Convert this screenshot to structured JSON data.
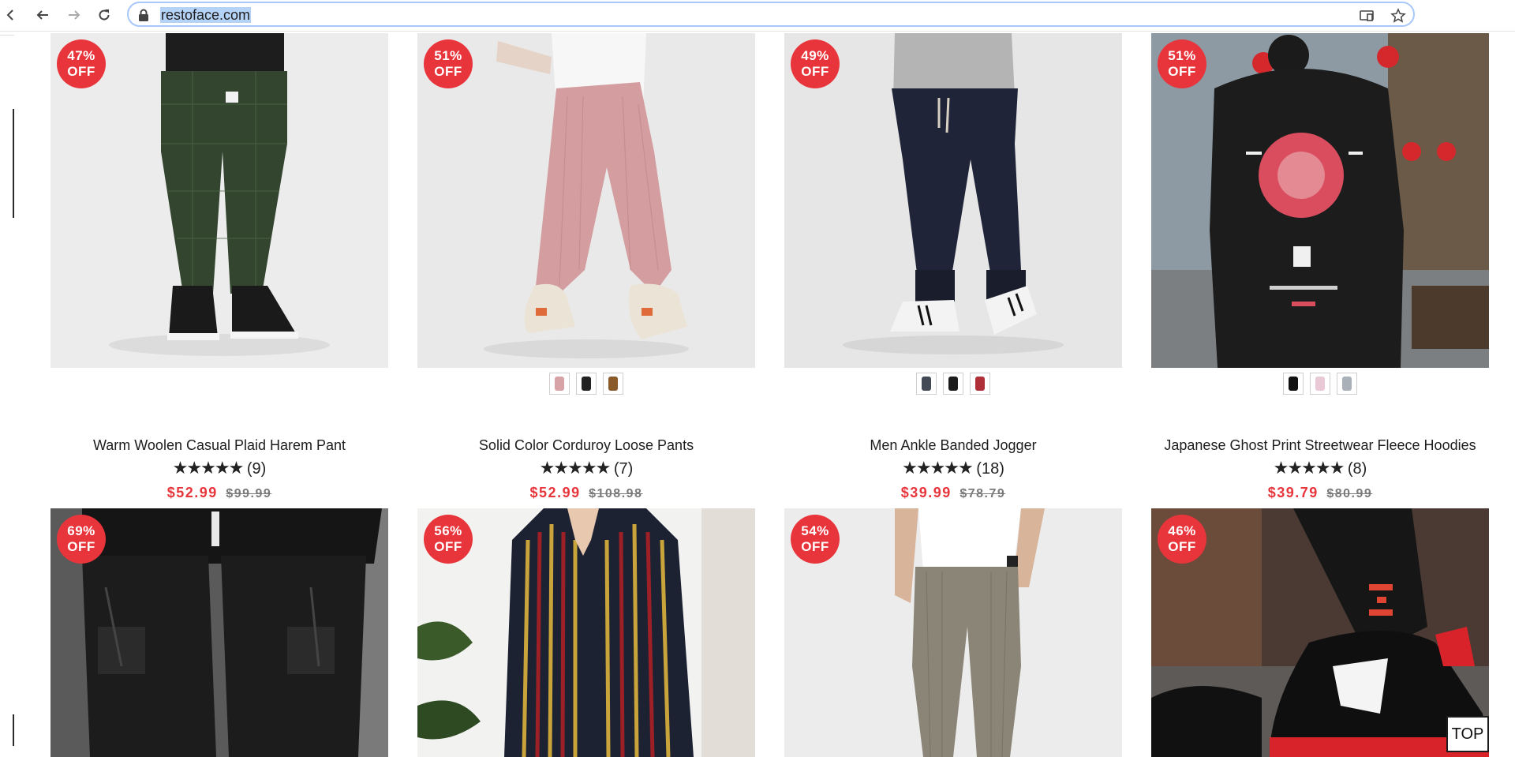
{
  "browser": {
    "url": "restoface.com",
    "icons": [
      "back-arrow-icon",
      "forward-arrow-icon",
      "reload-icon",
      "lock-icon",
      "cast-icon",
      "star-icon"
    ]
  },
  "colors": {
    "sale": "#e8353b",
    "badge": "#e8353b",
    "strike": "#7a7a7a"
  },
  "products": [
    {
      "badge_pct": "47%",
      "badge_off": "OFF",
      "title": "Warm Woolen Casual Plaid Harem Pant",
      "stars": "★★★★★",
      "count": "(9)",
      "price": "$52.99",
      "old_price": "$99.99",
      "swatches": []
    },
    {
      "badge_pct": "51%",
      "badge_off": "OFF",
      "title": "Solid Color Corduroy Loose Pants",
      "stars": "★★★★★",
      "count": "(7)",
      "price": "$52.99",
      "old_price": "$108.98",
      "swatches": [
        "#d8a3a6",
        "#222222",
        "#8a5a2b"
      ]
    },
    {
      "badge_pct": "49%",
      "badge_off": "OFF",
      "title": "Men Ankle Banded Jogger",
      "stars": "★★★★★",
      "count": "(18)",
      "price": "$39.99",
      "old_price": "$78.79",
      "swatches": [
        "#444a55",
        "#1b1b1b",
        "#b0303a"
      ]
    },
    {
      "badge_pct": "51%",
      "badge_off": "OFF",
      "title": "Japanese Ghost Print Streetwear Fleece Hoodies",
      "stars": "★★★★★",
      "count": "(8)",
      "price": "$39.79",
      "old_price": "$80.99",
      "swatches": [
        "#111111",
        "#e9c9d6",
        "#aab0b8"
      ]
    },
    {
      "badge_pct": "69%",
      "badge_off": "OFF"
    },
    {
      "badge_pct": "56%",
      "badge_off": "OFF"
    },
    {
      "badge_pct": "54%",
      "badge_off": "OFF"
    },
    {
      "badge_pct": "46%",
      "badge_off": "OFF"
    }
  ],
  "top_button": "TOP"
}
